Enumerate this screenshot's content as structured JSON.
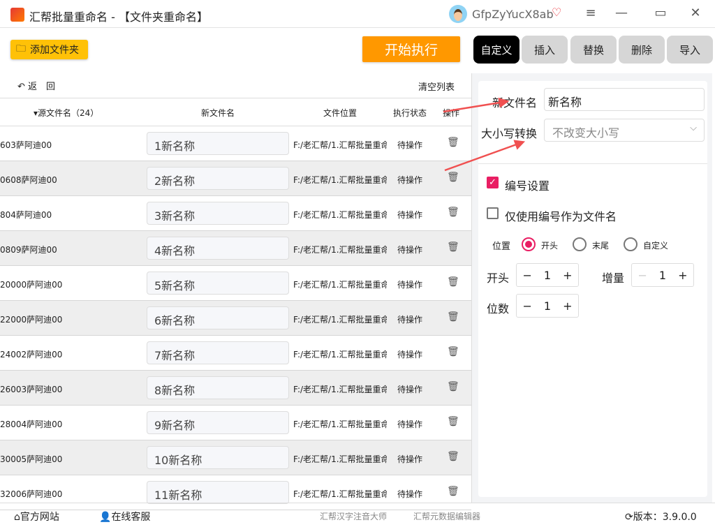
{
  "window": {
    "title": "汇帮批量重命名 - 【文件夹重命名】",
    "username": "GfpZyYucX8ab"
  },
  "toolbar": {
    "add_folder": "添加文件夹",
    "start": "开始执行",
    "back": "返　回",
    "clear": "清空列表"
  },
  "tabs": [
    {
      "label": "自定义",
      "active": true
    },
    {
      "label": "插入"
    },
    {
      "label": "替换"
    },
    {
      "label": "删除"
    },
    {
      "label": "导入"
    }
  ],
  "table": {
    "headers": {
      "source": "源文件名（24）",
      "new": "新文件名",
      "location": "文件位置",
      "status": "执行状态",
      "action": "操作"
    },
    "rows": [
      {
        "source": "603萨阿迪00",
        "new": "1新名称",
        "location": "F:/老汇帮/1.汇帮批量重命",
        "status": "待操作"
      },
      {
        "source": "0608萨阿迪00",
        "new": "2新名称",
        "location": "F:/老汇帮/1.汇帮批量重命",
        "status": "待操作"
      },
      {
        "source": "804萨阿迪00",
        "new": "3新名称",
        "location": "F:/老汇帮/1.汇帮批量重命",
        "status": "待操作"
      },
      {
        "source": "0809萨阿迪00",
        "new": "4新名称",
        "location": "F:/老汇帮/1.汇帮批量重命",
        "status": "待操作"
      },
      {
        "source": "20000萨阿迪00",
        "new": "5新名称",
        "location": "F:/老汇帮/1.汇帮批量重命",
        "status": "待操作"
      },
      {
        "source": "22000萨阿迪00",
        "new": "6新名称",
        "location": "F:/老汇帮/1.汇帮批量重命",
        "status": "待操作"
      },
      {
        "source": "24002萨阿迪00",
        "new": "7新名称",
        "location": "F:/老汇帮/1.汇帮批量重命",
        "status": "待操作"
      },
      {
        "source": "26003萨阿迪00",
        "new": "8新名称",
        "location": "F:/老汇帮/1.汇帮批量重命",
        "status": "待操作"
      },
      {
        "source": "28004萨阿迪00",
        "new": "9新名称",
        "location": "F:/老汇帮/1.汇帮批量重命",
        "status": "待操作"
      },
      {
        "source": "30005萨阿迪00",
        "new": "10新名称",
        "location": "F:/老汇帮/1.汇帮批量重命",
        "status": "待操作"
      },
      {
        "source": "32006萨阿迪00",
        "new": "11新名称",
        "location": "F:/老汇帮/1.汇帮批量重命",
        "status": "待操作"
      }
    ]
  },
  "settings": {
    "new_name_label": "新文件名",
    "new_name_value": "新名称",
    "case_label": "大小写转换",
    "case_value": "不改变大小写",
    "numbering_label": "编号设置",
    "numbering_checked": true,
    "only_number_label": "仅使用编号作为文件名",
    "only_number_checked": false,
    "position_label": "位置",
    "positions": [
      "开头",
      "末尾",
      "自定义"
    ],
    "position_selected": "开头",
    "start_label": "开头",
    "start_value": "1",
    "increment_label": "增量",
    "increment_value": "1",
    "digits_label": "位数",
    "digits_value": "1"
  },
  "footer": {
    "website": "官方网站",
    "support": "在线客服",
    "link1": "汇帮汉字注音大师",
    "link2": "汇帮元数据编辑器",
    "version": "版本：3.9.0.0"
  },
  "colors": {
    "accent": "#e91e63",
    "start": "#ff9800",
    "add": "#ffc107",
    "arrow": "#f05050"
  }
}
